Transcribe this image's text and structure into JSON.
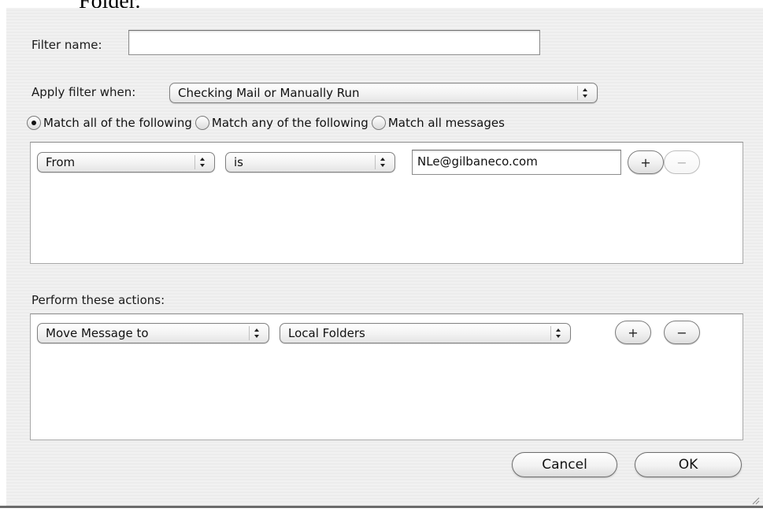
{
  "document_fragment": "Folder.",
  "filter_name": {
    "label": "Filter name:",
    "value": ""
  },
  "apply_when": {
    "label": "Apply filter when:",
    "selected": "Checking Mail or Manually Run"
  },
  "match_options": [
    {
      "label": "Match all of the following",
      "selected": true
    },
    {
      "label": "Match any of the following",
      "selected": false
    },
    {
      "label": "Match all messages",
      "selected": false
    }
  ],
  "criteria": {
    "field": "From",
    "operator": "is",
    "value": "NLe@gilbaneco.com",
    "add_label": "+",
    "remove_label": "−"
  },
  "actions": {
    "label": "Perform these actions:",
    "action": "Move Message to",
    "target": "Local Folders",
    "add_label": "+",
    "remove_label": "−"
  },
  "buttons": {
    "cancel": "Cancel",
    "ok": "OK"
  },
  "icons": {
    "popup_arrows": "updown-arrows-icon",
    "resize": "resize-grip-icon"
  }
}
